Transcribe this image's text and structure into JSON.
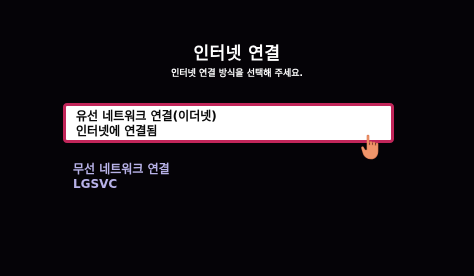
{
  "header": {
    "title": "인터넷 연결",
    "subtitle": "인터넷 연결 방식을 선택해 주세요."
  },
  "options": [
    {
      "label": "유선 네트워크 연결(이더넷)",
      "status": "인터넷에 연결됨",
      "selected": true
    },
    {
      "label": "무선 네트워크 연결",
      "status": "LGSVC",
      "selected": false
    }
  ],
  "colors": {
    "background": "#050307",
    "focus_border": "#c2265a",
    "wireless_text": "#b8b2e8",
    "pointer": "#f0956a"
  },
  "pointer_icon": "hand-pointer-icon"
}
